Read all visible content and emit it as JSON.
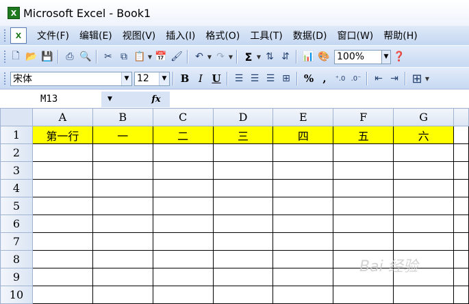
{
  "window": {
    "title": "Microsoft Excel - Book1",
    "app_icon_glyph": "X"
  },
  "menu": {
    "items": [
      "文件(F)",
      "编辑(E)",
      "视图(V)",
      "插入(I)",
      "格式(O)",
      "工具(T)",
      "数据(D)",
      "窗口(W)",
      "帮助(H)"
    ]
  },
  "standard_toolbar": {
    "sum_glyph": "Σ",
    "zoom": "100%"
  },
  "format_toolbar": {
    "font_name": "宋体",
    "font_size": "12",
    "bold": "B",
    "italic": "I",
    "underline": "U",
    "percent": "%",
    "comma": ","
  },
  "formula_bar": {
    "name_box": "M13",
    "fx_label": "fx",
    "formula": ""
  },
  "sheet": {
    "columns": [
      "A",
      "B",
      "C",
      "D",
      "E",
      "F",
      "G"
    ],
    "rows": [
      {
        "num": "1",
        "cells": [
          "第一行",
          "一",
          "二",
          "三",
          "四",
          "五",
          "六"
        ]
      },
      {
        "num": "2",
        "cells": [
          "",
          "",
          "",
          "",
          "",
          "",
          ""
        ]
      },
      {
        "num": "3",
        "cells": [
          "",
          "",
          "",
          "",
          "",
          "",
          ""
        ]
      },
      {
        "num": "4",
        "cells": [
          "",
          "",
          "",
          "",
          "",
          "",
          ""
        ]
      },
      {
        "num": "5",
        "cells": [
          "",
          "",
          "",
          "",
          "",
          "",
          ""
        ]
      },
      {
        "num": "6",
        "cells": [
          "",
          "",
          "",
          "",
          "",
          "",
          ""
        ]
      },
      {
        "num": "7",
        "cells": [
          "",
          "",
          "",
          "",
          "",
          "",
          ""
        ]
      },
      {
        "num": "8",
        "cells": [
          "",
          "",
          "",
          "",
          "",
          "",
          ""
        ]
      },
      {
        "num": "9",
        "cells": [
          "",
          "",
          "",
          "",
          "",
          "",
          ""
        ]
      },
      {
        "num": "10",
        "cells": [
          "",
          "",
          "",
          "",
          "",
          "",
          ""
        ]
      }
    ],
    "highlight_color": "#ffff00"
  },
  "watermark": "Bai 经验"
}
